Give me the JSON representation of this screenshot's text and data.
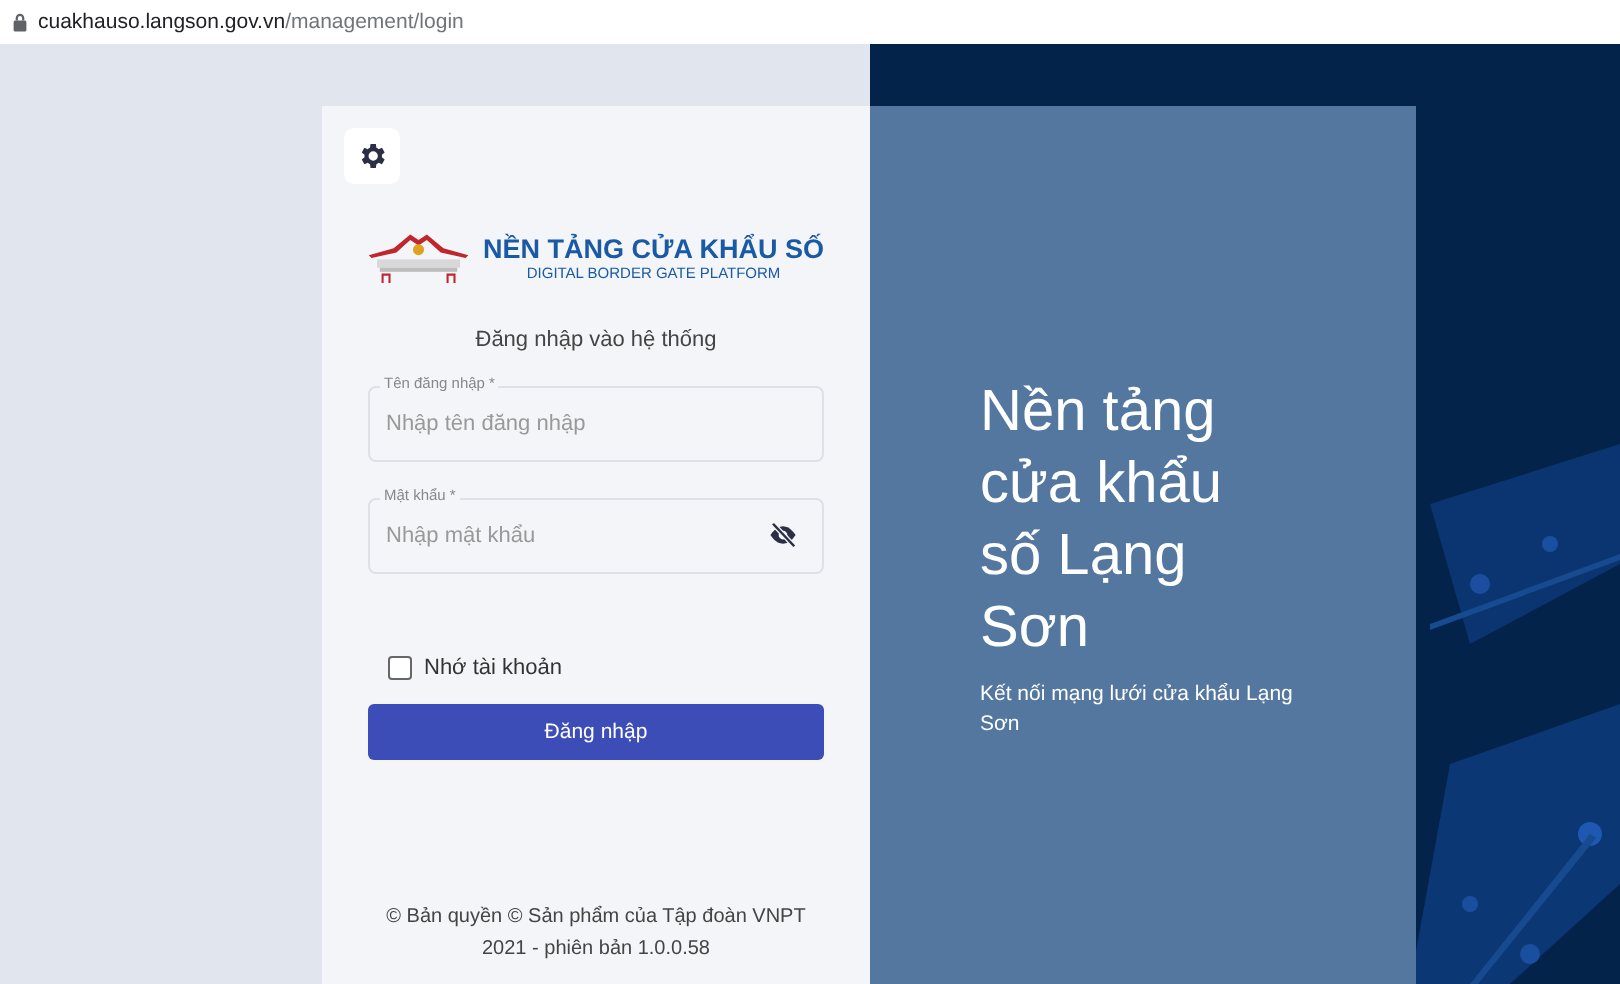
{
  "browser": {
    "url_host": "cuakhauso.langson.gov.vn",
    "url_path": "/management/login"
  },
  "login_card": {
    "logo": {
      "title": "NỀN TẢNG CỬA KHẨU SỐ",
      "subtitle": "DIGITAL BORDER GATE PLATFORM"
    },
    "heading": "Đăng nhập vào hệ thống",
    "fields": [
      {
        "kind": "text",
        "label": "Tên đăng nhập *",
        "placeholder": "Nhập tên đăng nhập"
      },
      {
        "kind": "password",
        "label": "Mật khẩu *",
        "placeholder": "Nhập mật khẩu"
      }
    ],
    "remember": {
      "label": "Nhớ tài khoản",
      "checked": false
    },
    "submit": "Đăng nhập",
    "footer": "© Bản quyền © Sản phẩm của Tập đoàn VNPT 2021 - phiên bản 1.0.0.58"
  },
  "hero": {
    "title": "Nền tảng cửa khẩu số Lạng Sơn",
    "subtitle": "Kết nối mạng lưới cửa khẩu Lạng Sơn"
  }
}
